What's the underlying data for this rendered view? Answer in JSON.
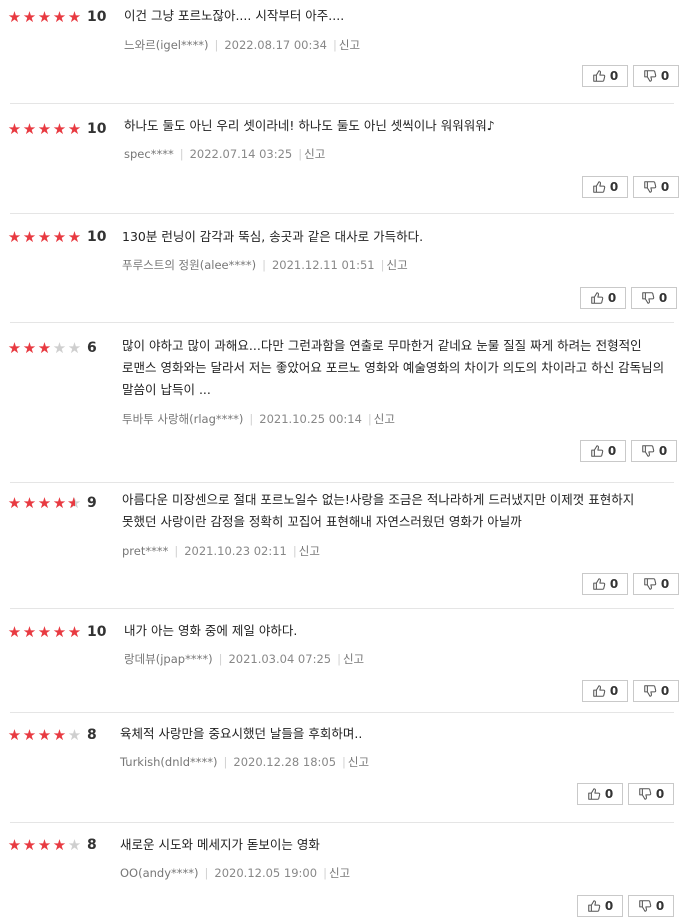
{
  "reviews": [
    {
      "stars": [
        1,
        1,
        1,
        1,
        1
      ],
      "score": "10",
      "text": "이건 그냥 포르노잖아.... 시작부터 아주....",
      "author": "느와르(igel****)",
      "date": "2022.08.17 00:34",
      "report": "신고",
      "up": "0",
      "down": "0"
    },
    {
      "stars": [
        1,
        1,
        1,
        1,
        1
      ],
      "score": "10",
      "text": "하나도 둘도 아닌 우리 셋이라네! 하나도 둘도 아닌 셋씩이나 워워워워♪",
      "author": "spec****",
      "date": "2022.07.14 03:25",
      "report": "신고",
      "up": "0",
      "down": "0"
    },
    {
      "stars": [
        1,
        1,
        1,
        1,
        1
      ],
      "score": "10",
      "text": "130분 런닝이 감각과 뚝심, 송곳과 같은 대사로 가득하다.",
      "author": "푸루스트의 정원(alee****)",
      "date": "2021.12.11 01:51",
      "report": "신고",
      "up": "0",
      "down": "0"
    },
    {
      "stars": [
        1,
        1,
        1,
        0,
        0
      ],
      "score": "6",
      "text": "많이 야하고 많이 과해요...다만 그런과함을 연출로 무마한거 같네요 눈물 질질 짜게 하려는 전형적인 로맨스 영화와는 달라서 저는 좋았어요 포르노 영화와 예술영화의 차이가 의도의 차이라고 하신 감독님의 말씀이 납득이 ...",
      "author": "투바투 사랑해(rlag****)",
      "date": "2021.10.25 00:14",
      "report": "신고",
      "up": "0",
      "down": "0"
    },
    {
      "stars": [
        1,
        1,
        1,
        1,
        0.5
      ],
      "score": "9",
      "text": "아름다운 미장센으로 절대 포르노일수 없는!사랑을 조금은 적나라하게 드러냈지만 이제껏 표현하지 못했던 사랑이란 감정을 정확히 꼬집어 표현해내 자연스러웠던 영화가 아닐까",
      "author": "pret****",
      "date": "2021.10.23 02:11",
      "report": "신고",
      "up": "0",
      "down": "0"
    },
    {
      "stars": [
        1,
        1,
        1,
        1,
        1
      ],
      "score": "10",
      "text": "내가 아는 영화 중에 제일 야하다.",
      "author": "랑데뷰(jpap****)",
      "date": "2021.03.04 07:25",
      "report": "신고",
      "up": "0",
      "down": "0"
    },
    {
      "stars": [
        1,
        1,
        1,
        1,
        0
      ],
      "score": "8",
      "text": "육체적 사랑만을 중요시했던 날들을 후회하며..",
      "author": "Turkish(dnld****)",
      "date": "2020.12.28 18:05",
      "report": "신고",
      "up": "0",
      "down": "0"
    },
    {
      "stars": [
        1,
        1,
        1,
        1,
        0
      ],
      "score": "8",
      "text": "새로운 시도와 메세지가 돋보이는 영화",
      "author": "OO(andy****)",
      "date": "2020.12.05 19:00",
      "report": "신고",
      "up": "0",
      "down": "0"
    }
  ]
}
